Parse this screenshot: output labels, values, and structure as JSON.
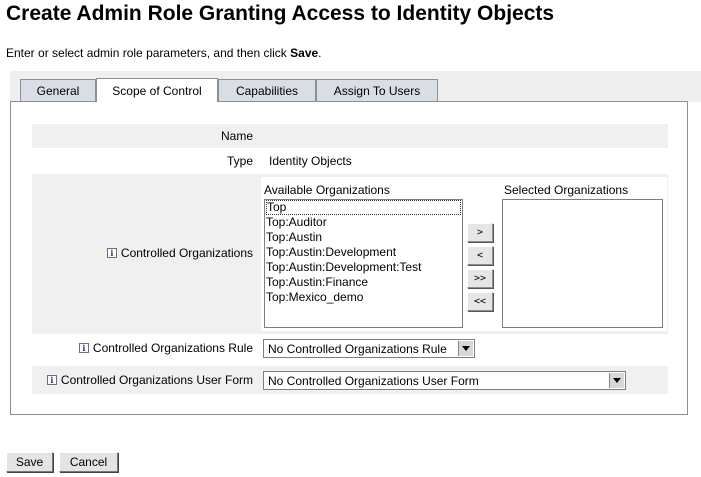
{
  "page": {
    "title": "Create Admin Role Granting Access to Identity Objects",
    "instruction_prefix": "Enter or select admin role parameters, and then click ",
    "instruction_bold": "Save",
    "instruction_suffix": "."
  },
  "tabs": [
    {
      "label": "General",
      "active": false
    },
    {
      "label": "Scope of Control",
      "active": true
    },
    {
      "label": "Capabilities",
      "active": false
    },
    {
      "label": "Assign To Users",
      "active": false
    }
  ],
  "form": {
    "name_label": "Name",
    "name_value": "",
    "type_label": "Type",
    "type_value": "Identity Objects",
    "controlled_orgs": {
      "label": "Controlled Organizations",
      "available_caption": "Available Organizations",
      "selected_caption": "Selected Organizations",
      "available": [
        "Top",
        "Top:Auditor",
        "Top:Austin",
        "Top:Austin:Development",
        "Top:Austin:Development:Test",
        "Top:Austin:Finance",
        "Top:Mexico_demo"
      ],
      "selected": [],
      "move_buttons": [
        ">",
        "<",
        ">>",
        "<<"
      ]
    },
    "rule": {
      "label": "Controlled Organizations Rule",
      "selected": "No Controlled Organizations Rule"
    },
    "user_form": {
      "label": "Controlled Organizations User Form",
      "selected": "No Controlled Organizations User Form"
    }
  },
  "buttons": {
    "save": "Save",
    "cancel": "Cancel"
  },
  "icons": {
    "info": "info-icon"
  }
}
